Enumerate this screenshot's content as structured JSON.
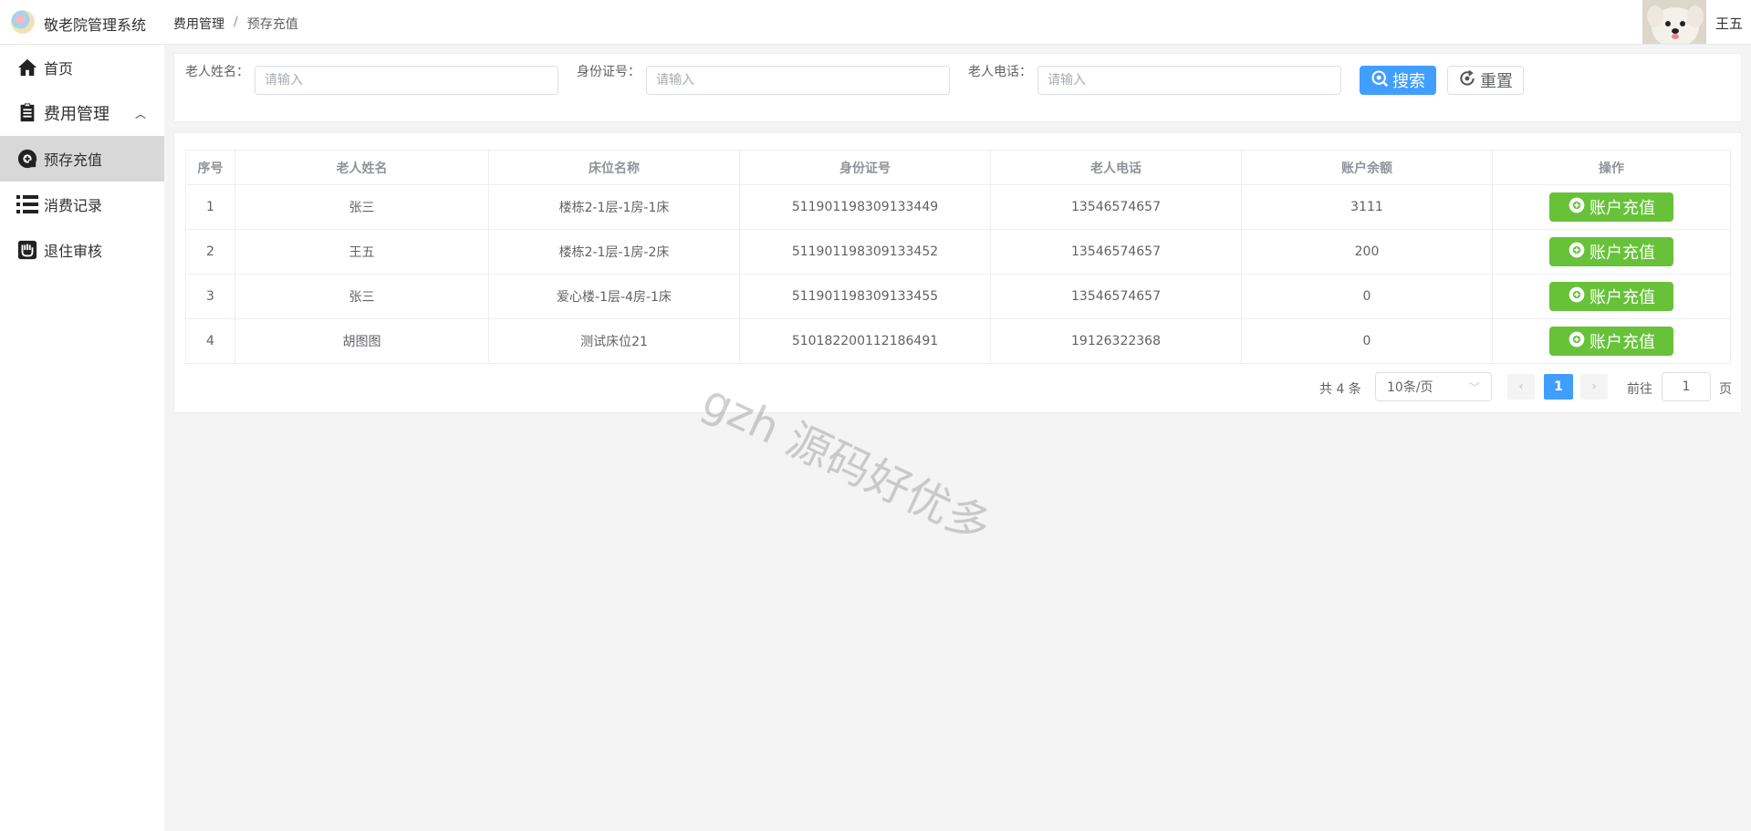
{
  "app": {
    "title": "敬老院管理系统",
    "user_name": "王五"
  },
  "breadcrumb": {
    "parent": "费用管理",
    "separator": "/",
    "current": "预存充值"
  },
  "sidebar": {
    "items": [
      {
        "label": "首页",
        "icon": "home-icon"
      },
      {
        "label": "费用管理",
        "icon": "document-icon"
      },
      {
        "label": "预存充值",
        "icon": "recharge-icon",
        "active": true
      },
      {
        "label": "消费记录",
        "icon": "list-icon"
      },
      {
        "label": "退住审核",
        "icon": "audit-icon"
      }
    ]
  },
  "search": {
    "name_label": "老人姓名：",
    "name_placeholder": "请输入",
    "idcard_label": "身份证号：",
    "idcard_placeholder": "请输入",
    "phone_label": "老人电话：",
    "phone_placeholder": "请输入",
    "search_button": "搜索",
    "reset_button": "重置"
  },
  "table": {
    "columns": [
      "序号",
      "老人姓名",
      "床位名称",
      "身份证号",
      "老人电话",
      "账户余额",
      "操作"
    ],
    "rows": [
      {
        "index": "1",
        "name": "张三",
        "bed": "楼栋2-1层-1房-1床",
        "idcard": "511901198309133449",
        "phone": "13546574657",
        "balance": "3111"
      },
      {
        "index": "2",
        "name": "王五",
        "bed": "楼栋2-1层-1房-2床",
        "idcard": "511901198309133452",
        "phone": "13546574657",
        "balance": "200"
      },
      {
        "index": "3",
        "name": "张三",
        "bed": "爱心楼-1层-4房-1床",
        "idcard": "511901198309133455",
        "phone": "13546574657",
        "balance": "0"
      },
      {
        "index": "4",
        "name": "胡图图",
        "bed": "测试床位21",
        "idcard": "510182200112186491",
        "phone": "19126322368",
        "balance": "0"
      }
    ],
    "action_label": "账户充值"
  },
  "pagination": {
    "total_text": "共 4 条",
    "page_size": "10条/页",
    "current_page": "1",
    "goto_label": "前往",
    "goto_value": "1",
    "page_suffix": "页"
  },
  "watermark": "gzh 源码好优多",
  "colors": {
    "primary": "#409eff",
    "success": "#67c23a",
    "active_menu_bg": "#d8d8d8"
  }
}
